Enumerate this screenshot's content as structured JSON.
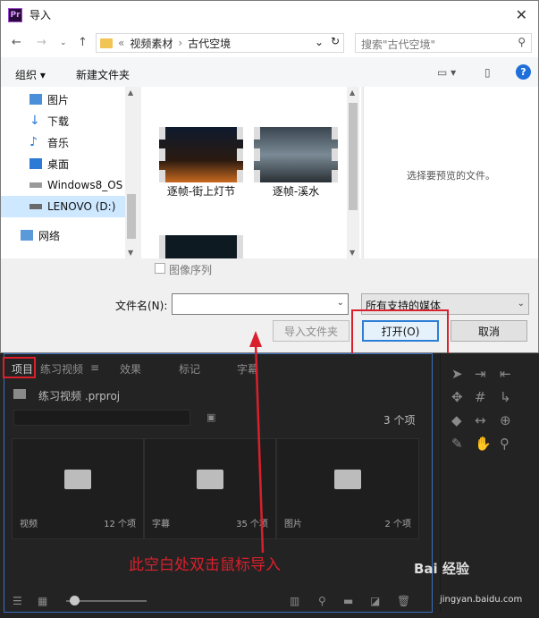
{
  "window": {
    "title": "导入",
    "app_icon_text": "Pr"
  },
  "nav": {
    "breadcrumb_prefix": "«",
    "breadcrumb": [
      "视频素材",
      "古代空境"
    ],
    "search_placeholder": "搜索\"古代空境\""
  },
  "toolbar": {
    "organize": "组织 ▾",
    "new_folder": "新建文件夹"
  },
  "sidebar": {
    "items": [
      {
        "label": "图片",
        "icon": "pictures-icon"
      },
      {
        "label": "下载",
        "icon": "download-icon"
      },
      {
        "label": "音乐",
        "icon": "music-icon"
      },
      {
        "label": "桌面",
        "icon": "desktop-icon"
      },
      {
        "label": "Windows8_OS",
        "icon": "drive-icon"
      },
      {
        "label": "LENOVO (D:)",
        "icon": "drive-icon"
      },
      {
        "label": "网络",
        "icon": "network-icon"
      }
    ]
  },
  "files": [
    {
      "name": "逐帧-街上灯节"
    },
    {
      "name": "逐帧-溪水"
    },
    {
      "name": ""
    }
  ],
  "preview": {
    "text": "选择要预览的文件。"
  },
  "options": {
    "image_sequence": "图像序列"
  },
  "footer": {
    "filename_label": "文件名(N):",
    "filename_value": "",
    "filetype": "所有支持的媒体",
    "import_folder": "导入文件夹",
    "open": "打开(O)",
    "cancel": "取消"
  },
  "premiere": {
    "tabs": [
      "项目",
      "练习视频",
      "效果",
      "标记",
      "字幕"
    ],
    "project_file": "练习视频 .prproj",
    "item_count": "3 个项",
    "bins": [
      {
        "name": "视频",
        "count": "12 个项"
      },
      {
        "name": "字幕",
        "count": "35 个项"
      },
      {
        "name": "图片",
        "count": "2 个项"
      }
    ]
  },
  "annotation": {
    "text": "此空白处双击鼠标导入"
  },
  "watermark": {
    "logo": "Bai 经验",
    "url": "jingyan.baidu.com"
  },
  "colors": {
    "annotation_red": "#d9202c",
    "accent_blue": "#2d7fd6"
  }
}
